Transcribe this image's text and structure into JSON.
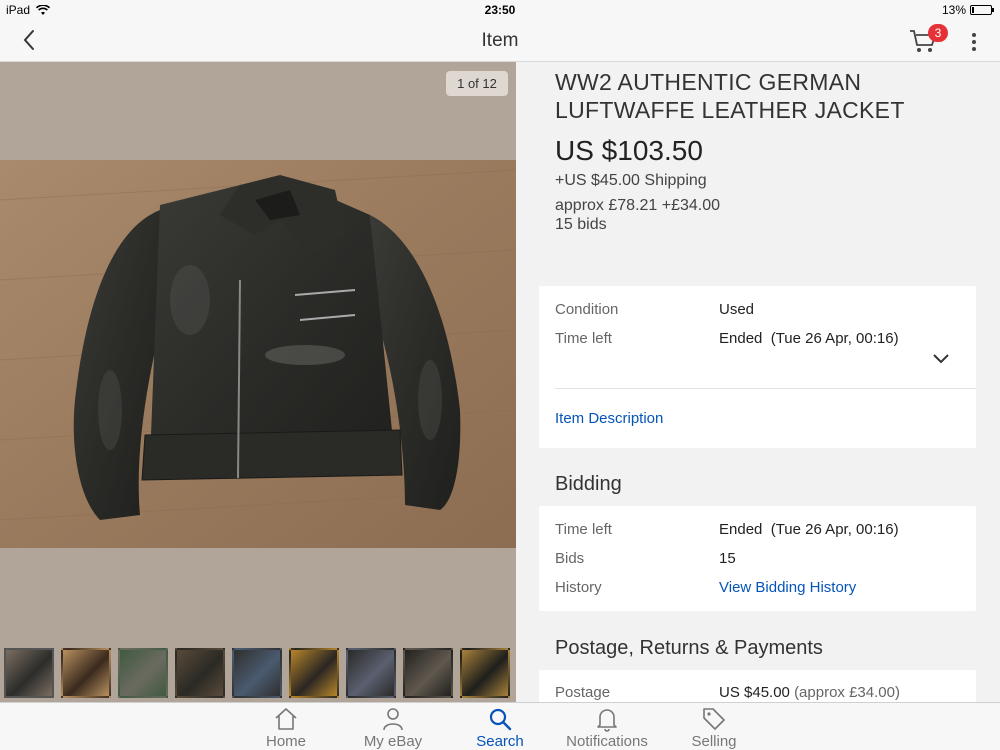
{
  "status_bar": {
    "device": "iPad",
    "time": "23:50",
    "battery": "13%",
    "battery_level": 0.13
  },
  "nav": {
    "title": "Item",
    "cart_count": "3"
  },
  "gallery": {
    "counter": "1 of 12",
    "thumbnail_count": 9,
    "selected_index": 0
  },
  "item": {
    "title": "WW2 AUTHENTIC GERMAN LUFTWAFFE LEATHER JACKET",
    "price": "US $103.50",
    "shipping": "+US $45.00 Shipping",
    "approx": "approx £78.21 +£34.00",
    "bids": "15 bids"
  },
  "summary": {
    "condition_label": "Condition",
    "condition_value": "Used",
    "time_left_label": "Time left",
    "time_left_value": "Ended  (Tue 26 Apr, 00:16)",
    "item_description": "Item Description"
  },
  "bidding": {
    "heading": "Bidding",
    "time_left_label": "Time left",
    "time_left_value": "Ended  (Tue 26 Apr, 00:16)",
    "bids_label": "Bids",
    "bids_value": "15",
    "history_label": "History",
    "history_link": "View Bidding History"
  },
  "postage": {
    "heading": "Postage, Returns & Payments",
    "postage_label": "Postage",
    "postage_value": "US $45.00",
    "postage_approx": "(approx £34.00)"
  },
  "tabs": [
    {
      "label": "Home",
      "icon": "home-icon",
      "active": false
    },
    {
      "label": "My eBay",
      "icon": "person-icon",
      "active": false
    },
    {
      "label": "Search",
      "icon": "search-icon",
      "active": true
    },
    {
      "label": "Notifications",
      "icon": "bell-icon",
      "active": false
    },
    {
      "label": "Selling",
      "icon": "tag-icon",
      "active": false
    }
  ],
  "colors": {
    "accent": "#0654ba",
    "badge": "#e53238",
    "image_bg": "#b0a598"
  }
}
